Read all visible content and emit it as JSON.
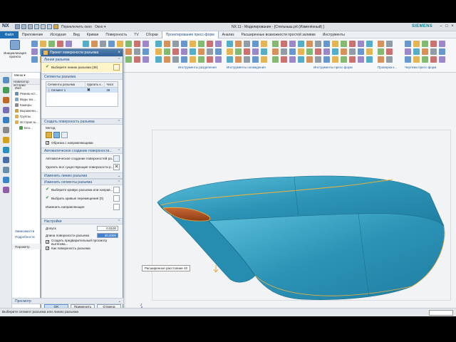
{
  "titlebar": {
    "logo": "NX",
    "quick_access_item": "Переключить окно",
    "window_menu": "Окно ▾",
    "title": "NX 11 - Моделирование - [Стельныш.prt (Изменённый) ]",
    "brand": "SIEMENS",
    "minimize": "–",
    "maximize": "□",
    "close": "×"
  },
  "menu": {
    "file": "Файл",
    "tabs": [
      "Приложение",
      "Исходная",
      "Вид",
      "Кривая",
      "Поверхность",
      "TV",
      "Сборки",
      "Проектирование пресс-форм",
      "Анализ",
      "Расширенные возможности простой заливки",
      "Инструменты"
    ]
  },
  "ribbon": {
    "left_label": "Инициализация проекта",
    "group_labels": [
      "Инструменты разделения",
      "Инструменты охлаждения",
      "Инструменты пресс-форм",
      "Проверка к...",
      "Чертежи пресс-форм"
    ]
  },
  "navigator": {
    "menu_label": "Меню ▾",
    "title": "Навигатор истории",
    "column": "Имя",
    "items": [
      "Режим ист...",
      "Виды мо...",
      "Камеры",
      "Выражени...",
      "Группы",
      "История м...",
      "Бло..."
    ],
    "bottom_items": [
      "Зависимости",
      "Подробности",
      "Параметр"
    ]
  },
  "dialog": {
    "title": "Проект поверхности разъема",
    "close": "×",
    "sections": {
      "parting_line": "Линия разъема",
      "parting_segments": "Сегменты разъема",
      "create_surface": "Создать поверхность разъема",
      "auto_create": "Автоматическое создание поверхности...",
      "edit_line": "Изменить линию разъема",
      "edit_segments": "Изменить сегменты разъема",
      "settings": "Настройки",
      "preview": "Просмотр"
    },
    "select_line_label": "Выберите линию разъема (36)",
    "table": {
      "headers": [
        "Сегменты разъема",
        "Удалить к...",
        "Числ"
      ],
      "rows": [
        {
          "name": "Сегмент 1",
          "count": "36"
        }
      ]
    },
    "method_label": "Метод",
    "guide_checkbox": "Обрезка с направляющими",
    "auto_create_label": "Автоматическое создание поверхностей ра...",
    "delete_all_label": "Удалить все существующие поверхности р...",
    "select_curve_label": "Выберите кривую разъема или направ...",
    "select_transition_label": "Выбрать кривые перемещения (0)",
    "edit_guides_label": "Изменить направляющие",
    "tolerance_label": "Допуск",
    "tolerance_value": "0.0100",
    "surface_length_label": "Длина поверхности разъема",
    "surface_length_value": "40.0000",
    "preview_checkbox": "Создать предварительный просмотр вытягива...",
    "as_surface_checkbox": "Как поверхность разъема",
    "ok": "OK",
    "apply": "Применить",
    "cancel": "Отмена"
  },
  "viewport": {
    "tooltip": "Расширенное расстояние 40",
    "axis_x": "X",
    "axis_y": "Y",
    "axis_z": "Z"
  },
  "status": {
    "prompt": "Выберите сегмент разъема или линию разъема"
  },
  "colors": {
    "accent": "#1f6fb5",
    "surface": "#2f9ab8",
    "inner_face": "#b8562a",
    "highlight": "#f2b238"
  }
}
